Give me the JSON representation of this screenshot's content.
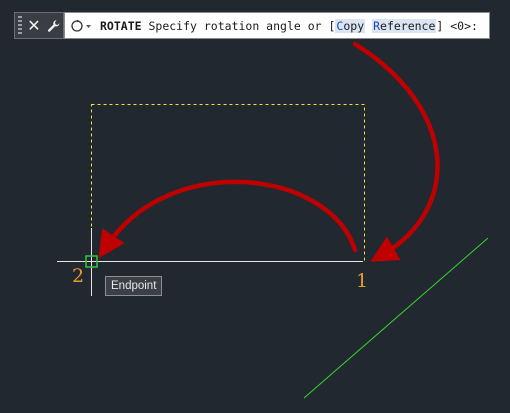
{
  "command_bar": {
    "close_icon": "close-icon",
    "customize_icon": "wrench-icon",
    "recent_icon": "recent-commands-icon",
    "command_name": "ROTATE",
    "prompt_text": "Specify rotation angle or [",
    "option_copy_key": "C",
    "option_copy_rest": "opy",
    "option_reference_key": "R",
    "option_reference_rest": "eference",
    "prompt_end": "] <0>:"
  },
  "drawing": {
    "point_1_label": "1",
    "point_2_label": "2",
    "osnap_tooltip": "Endpoint",
    "colors": {
      "background": "#212830",
      "selection_dashed": "#f3e23a",
      "object_line": "#e6e6e6",
      "green_line": "#38d12e",
      "arrow": "#c00000",
      "osnap_marker": "#34c43a",
      "point_labels": "#e69b2e"
    }
  }
}
